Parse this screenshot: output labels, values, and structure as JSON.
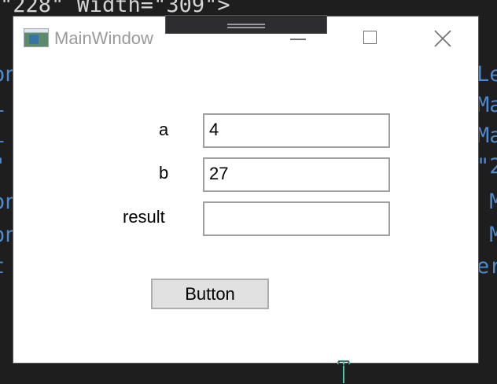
{
  "background_code": {
    "top_line": "\"228\" Width=\"309\">",
    "left_fragments": [
      "on",
      "i",
      "i",
      "\"",
      "on",
      "on",
      "t"
    ],
    "right_fragments": [
      "Le",
      "Ma",
      "Ma",
      "\"2",
      " M",
      " M",
      "er"
    ]
  },
  "window": {
    "title": "MainWindow",
    "labels": {
      "a": "a",
      "b": "b",
      "result": "result"
    },
    "inputs": {
      "a_value": "4",
      "b_value": "27",
      "result_value": ""
    },
    "button_label": "Button"
  },
  "colors": {
    "editor_bg": "#1e1e1e",
    "window_bg": "#ffffff",
    "button_bg": "#e1e1e1",
    "cursor": "#4ec9b0"
  }
}
